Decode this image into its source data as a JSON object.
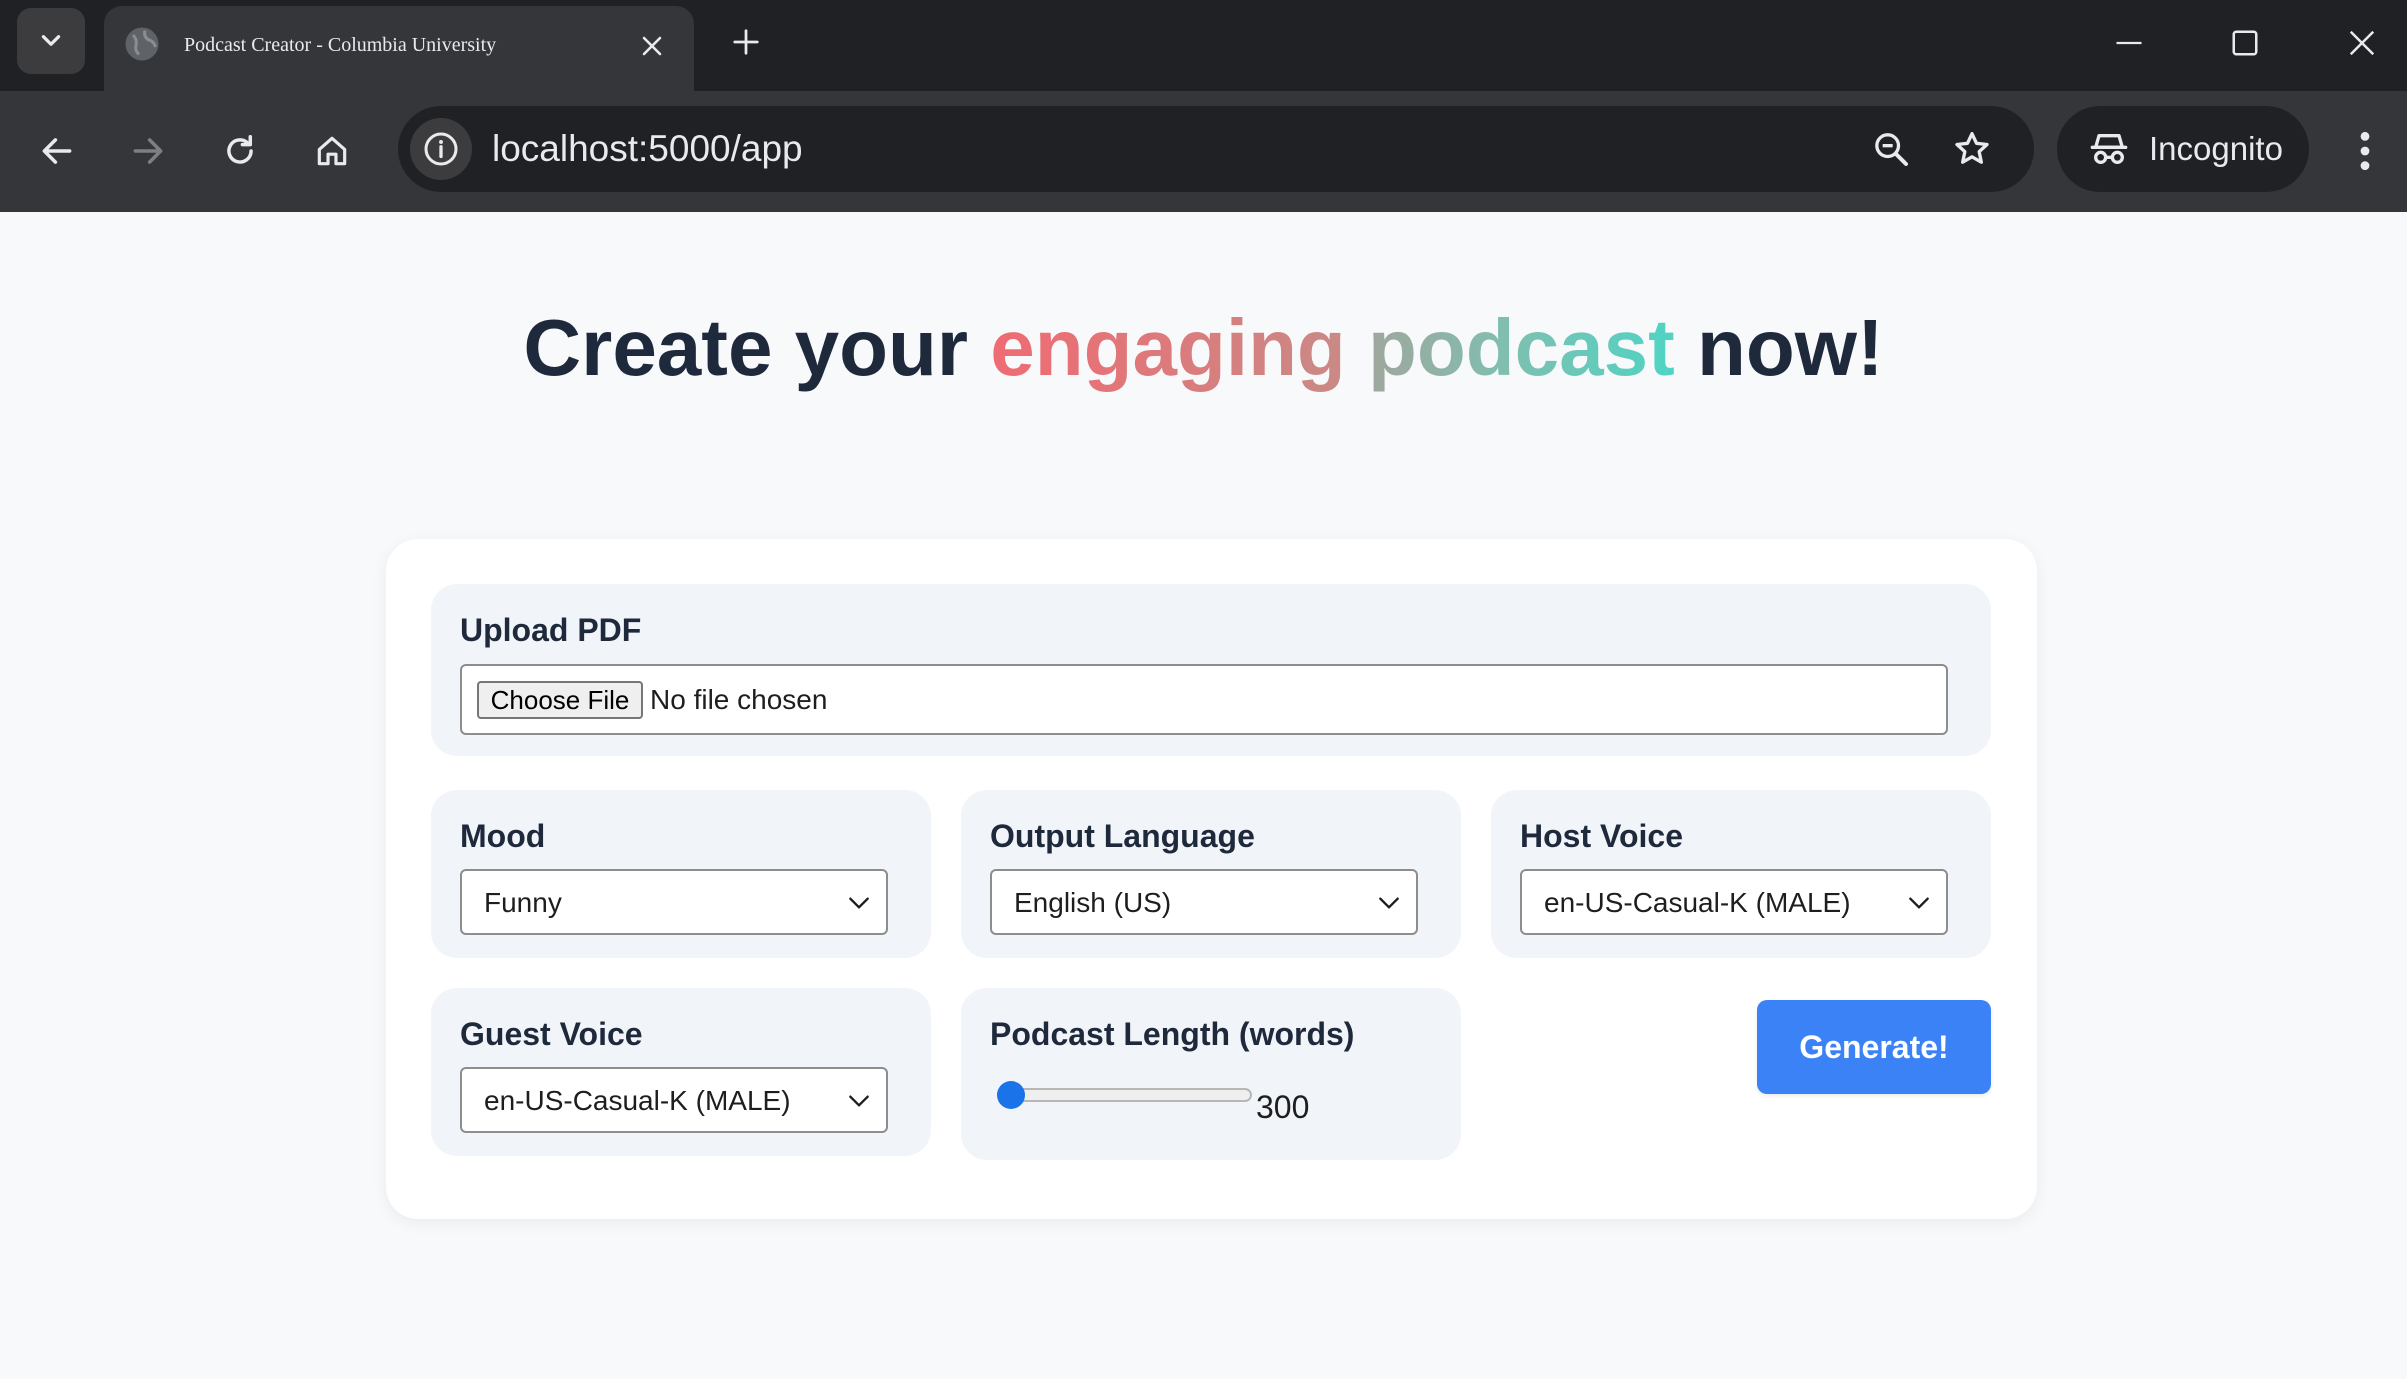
{
  "browser": {
    "tab": {
      "title": "Podcast Creator - Columbia University"
    },
    "address_bar": {
      "url": "localhost:5000/app"
    },
    "profile": {
      "label": "Incognito"
    }
  },
  "page": {
    "headline": {
      "part1": "Create your ",
      "highlight1": "engaging",
      "space": " ",
      "highlight2": "podcast",
      "part2": " now!"
    },
    "form": {
      "upload": {
        "label": "Upload PDF",
        "button_label": "Choose File",
        "status": "No file chosen"
      },
      "mood": {
        "label": "Mood",
        "value": "Funny"
      },
      "output_language": {
        "label": "Output Language",
        "value": "English (US)"
      },
      "host_voice": {
        "label": "Host Voice",
        "value": "en-US-Casual-K (MALE)"
      },
      "guest_voice": {
        "label": "Guest Voice",
        "value": "en-US-Casual-K (MALE)"
      },
      "podcast_length": {
        "label": "Podcast Length (words)",
        "value": "300",
        "fill_fraction": 0.0
      },
      "generate_label": "Generate!"
    }
  },
  "colors": {
    "accent": "#3b82f6",
    "heading": "#1e293b",
    "gradient_warm": "#ef6b72",
    "gradient_teal": "#4fd4c4",
    "panel": "#f1f4f9"
  },
  "icons": {
    "tab_search": "chevron-down-icon",
    "favicon": "globe-icon",
    "tab_close": "close-icon",
    "new_tab": "plus-icon",
    "minimize": "minimize-icon",
    "maximize": "maximize-icon",
    "window_close": "close-icon",
    "back": "arrow-left-icon",
    "forward": "arrow-right-icon",
    "reload": "reload-icon",
    "home": "home-icon",
    "site_info": "info-icon",
    "zoom": "zoom-icon",
    "bookmark": "star-icon",
    "incognito": "incognito-icon",
    "menu": "more-vert-icon",
    "dropdown": "chevron-down-icon"
  }
}
